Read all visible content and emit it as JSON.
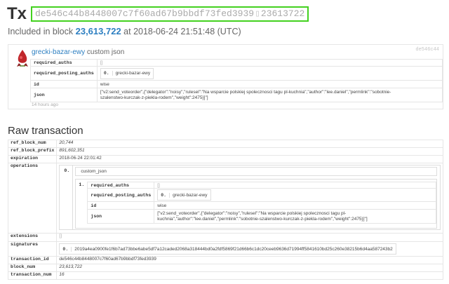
{
  "header": {
    "tx_label": "Tx",
    "hash": "de546c44b8448007c7f60ad67b9bbdf73fed3939",
    "hash_suffix": "23613722",
    "included_prefix": "Included in block",
    "block_num": "23,613,722",
    "included_at": "at 2018-06-24 21:51:48 (UTC)"
  },
  "op_card": {
    "op_id": "de546c44",
    "account": "grecki-bazar-ewy",
    "op_type": "custom json",
    "rows": {
      "required_auths_key": "required_auths",
      "required_auths_val": "[]",
      "required_posting_auths_key": "required_posting_auths",
      "posting_index": "0.",
      "posting_value": "grecki-bazar-ewy",
      "id_key": "id",
      "id_val": "wise",
      "json_key": "json",
      "json_val": "[\"v2:send_voteorder\",{\"delegator\":\"noisy\",\"rulesel\":\"Na wsparcie polskiej spolecznosci tagu pl-kuchnia\",\"author\":\"lee.daniel\",\"permlink\":\"sobotnie-szalenstwo-kurczak-z-piekla-rodem\",\"weight\":2475}]\"]"
    },
    "time_ago": "14 hours ago"
  },
  "raw": {
    "title": "Raw transaction",
    "ref_block_num_key": "ref_block_num",
    "ref_block_num_val": "20,744",
    "ref_block_prefix_key": "ref_block_prefix",
    "ref_block_prefix_val": "891,602,351",
    "expiration_key": "expiration",
    "expiration_val": "2018-06-24 22:01:42",
    "operations_key": "operations",
    "op_index0": "0.",
    "op_type": "custom_json",
    "op_index1": "1.",
    "inner": {
      "required_auths_key": "required_auths",
      "required_auths_val": "[]",
      "required_posting_auths_key": "required_posting_auths",
      "posting_index": "0.",
      "posting_value": "grecki-bazar-ewy",
      "id_key": "id",
      "id_val": "wise",
      "json_key": "json",
      "json_val": "[\"v2:send_voteorder\",{\"delegator\":\"noisy\",\"rulesel\":\"Na wsparcie polskiej spolecznosci tagu pl-kuchnia\",\"author\":\"lee.daniel\",\"permlink\":\"sobotnie-szalenstwo-kurczak-z-piekla-rodem\",\"weight\":2475}]\"]"
    },
    "extensions_key": "extensions",
    "extensions_val": "[]",
    "signatures_key": "signatures",
    "sig_index": "0.",
    "sig_val": "2019a4ea0900fe1f6b7ad73bbe6abe5df7a12caded2068a318444bd0a2fdf5869f21d66b6c1dc20ceeb9636d71994ff5841610bd25c260e38215b6d4aa587243b2",
    "transaction_id_key": "transaction_id",
    "transaction_id_val": "de546c44b8448007c7f60ad67b9bbdf73fed3939",
    "block_num_key": "block_num",
    "block_num_val": "23,613,722",
    "transaction_num_key": "transaction_num",
    "transaction_num_val": "16"
  },
  "colors": {
    "hash_border": "#43d11f",
    "link": "#2d7fc1"
  }
}
